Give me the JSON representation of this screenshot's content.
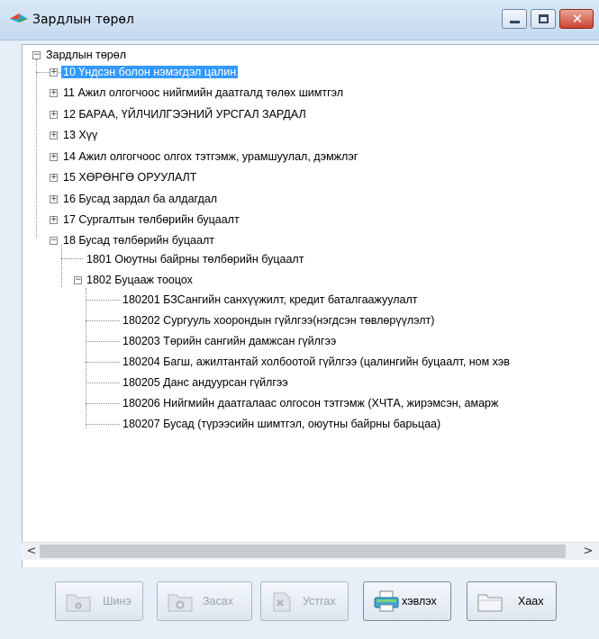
{
  "window": {
    "title": "Зардлын төрөл",
    "controls": {
      "minimize": "minimize",
      "maximize": "maximize",
      "close": "✕"
    }
  },
  "tree": {
    "root": "Зардлын төрөл",
    "items": [
      {
        "label": "10 Үндсэн болон нэмэгдэл цалин",
        "selected": true
      },
      {
        "label": "11 Ажил олгогчоос нийгмийн даатгалд төлөх шимтгэл"
      },
      {
        "label": "12 БАРАА, ҮЙЛЧИЛГЭЭНИЙ УРСГАЛ ЗАРДАЛ"
      },
      {
        "label": "13 Хүү"
      },
      {
        "label": "14 Ажил олгогчоос олгох тэтгэмж, урамшуулал, дэмжлэг"
      },
      {
        "label": "15 ХӨРӨНГӨ ОРУУЛАЛТ"
      },
      {
        "label": "16 Бусад зардал ба алдагдал"
      },
      {
        "label": "17 Сургалтын төлбөрийн буцаалт"
      },
      {
        "label": "18 Бусад төлбөрийн буцаалт"
      }
    ],
    "sub18": [
      {
        "label": "1801 Оюутны байрны төлбөрийн буцаалт"
      },
      {
        "label": "1802 Буцааж тооцох"
      }
    ],
    "sub1802": [
      "180201 БЗСангийн санхүүжилт, кредит баталгаажуулалт",
      "180202 Сургууль хоорондын гүйлгээ(нэгдсэн төвлөрүүлэлт)",
      "180203 Төрийн сангийн дамжсан гүйлгээ",
      "180204 Багш, ажилтантай холбоотой гүйлгээ (цалингийн буцаалт, ном хэв",
      "180205 Данс андуурсан гүйлгээ",
      "180206 Нийгмийн даатгалаас олгосон тэтгэмж (ХЧТА, жирэмсэн, амарж",
      "180207 Бусад (түрээсийн шимтгэл, оюутны байрны барьцаа)"
    ]
  },
  "scrollbar": {
    "left_arrow": "<",
    "right_arrow": ">"
  },
  "toolbar": {
    "new_label": "Шинэ",
    "edit_label": "Засах",
    "delete_label": "Устгах",
    "print_label": "хэвлэх",
    "close_label": "Хаах"
  },
  "colors": {
    "selection": "#3399ff",
    "close_button": "#c84430"
  }
}
